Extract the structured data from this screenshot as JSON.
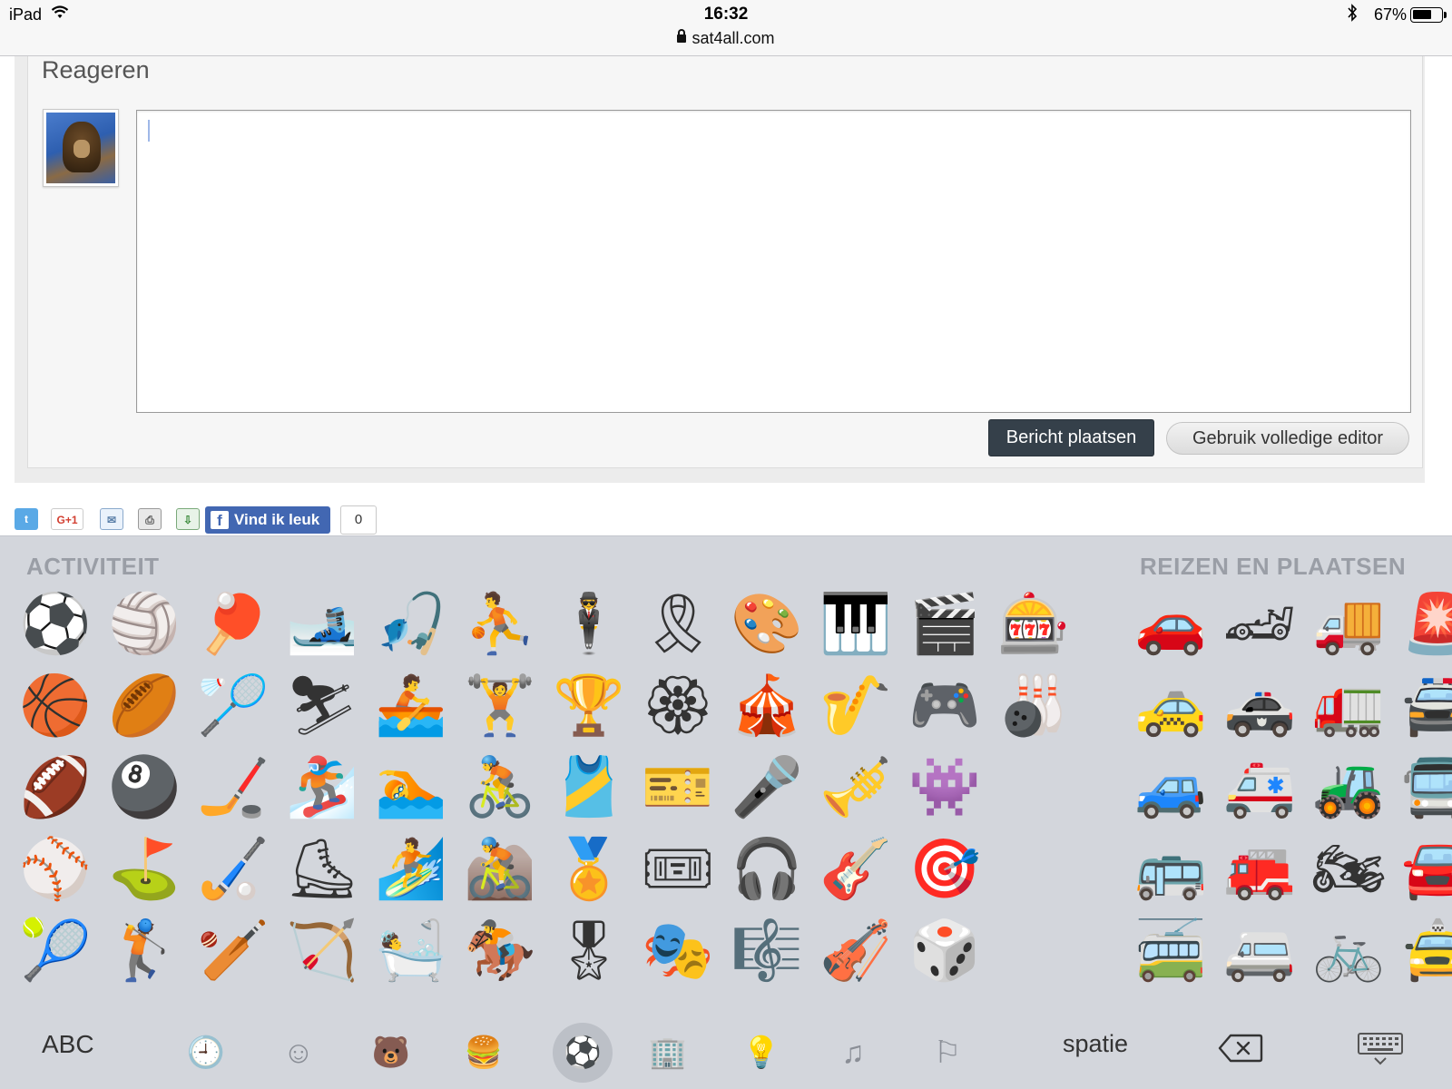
{
  "status_bar": {
    "device": "iPad",
    "time": "16:32",
    "url": "sat4all.com",
    "bluetooth_icon": "bluetooth-icon",
    "battery_pct": "67%"
  },
  "reply": {
    "title": "Reageren",
    "textarea_value": "",
    "post_button": "Bericht plaatsen",
    "full_editor_button": "Gebruik volledige editor"
  },
  "share": {
    "icons": [
      "twitter-icon",
      "google-plus-icon",
      "mail-icon",
      "print-icon",
      "download-icon"
    ],
    "gplus_label": "G+1",
    "fb_like_label": "Vind ik leuk",
    "fb_count": "0"
  },
  "keyboard": {
    "section_activity": "ACTIVITEIT",
    "section_travel": "REIZEN EN PLAATSEN",
    "activity_emojis": [
      "⚽",
      "🏀",
      "🏈",
      "⚾",
      "🎾",
      "🏐",
      "🏉",
      "🎱",
      "⛳",
      "🏌",
      "🏓",
      "🏸",
      "🏒",
      "🏑",
      "🏏",
      "🎿",
      "⛷",
      "🏂",
      "⛸",
      "🏹",
      "🎣",
      "🚣",
      "🏊",
      "🏄",
      "🛀",
      "⛹",
      "🏋",
      "🚴",
      "🚵",
      "🏇",
      "🕴",
      "🏆",
      "🎽",
      "🏅",
      "🎖",
      "🎗",
      "🏵",
      "🎫",
      "🎟",
      "🎭",
      "🎨",
      "🎪",
      "🎤",
      "🎧",
      "🎼",
      "🎹",
      "🎷",
      "🎺",
      "🎸",
      "🎻",
      "🎬",
      "🎮",
      "👾",
      "🎯",
      "🎲",
      "🎰",
      "🎳"
    ],
    "travel_emojis": [
      "🚗",
      "🚕",
      "🚙",
      "🚌",
      "🚎",
      "🏎",
      "🚓",
      "🚑",
      "🚒",
      "🚐",
      "🚚",
      "🚛",
      "🚜",
      "🏍",
      "🚲",
      "🚨",
      "🚔",
      "🚍",
      "🚘",
      "🚖"
    ],
    "abc_label": "ABC",
    "space_label": "spatie",
    "categories": [
      "recent-icon",
      "smiley-icon",
      "animal-icon",
      "food-icon",
      "activity-icon",
      "travel-icon",
      "objects-icon",
      "symbols-icon",
      "flags-icon"
    ],
    "category_glyphs": [
      "🕘",
      "☺",
      "🐻",
      "🍔",
      "⚽",
      "🏢",
      "💡",
      "♫",
      "⚐"
    ],
    "active_category": "activity-icon"
  }
}
